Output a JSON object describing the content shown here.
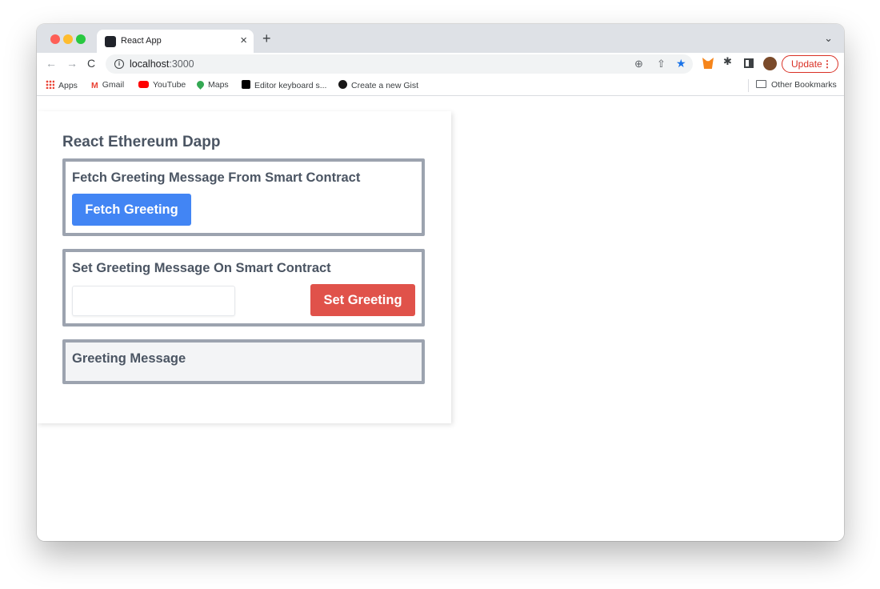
{
  "browser": {
    "tab_title": "React App",
    "tab_close": "×",
    "new_tab": "+",
    "tab_menu": "⌄",
    "url_host": "localhost",
    "url_port": ":3000",
    "update_label": "Update",
    "update_dots": "⋮",
    "nav_back": "←",
    "nav_forward": "→",
    "nav_reload": "C",
    "info_symbol": "i",
    "zoom_symbol": "⊕",
    "share_symbol": "⇧",
    "star_symbol": "★",
    "puzzle_symbol": "✱"
  },
  "bookmarks": {
    "items": [
      {
        "label": "Apps",
        "icon": "apps-grid-icon"
      },
      {
        "label": "Gmail",
        "icon": "gmail-icon"
      },
      {
        "label": "YouTube",
        "icon": "youtube-icon"
      },
      {
        "label": "Maps",
        "icon": "maps-icon"
      },
      {
        "label": "Editor keyboard s...",
        "icon": "medium-icon"
      },
      {
        "label": "Create a new Gist",
        "icon": "github-icon"
      }
    ],
    "other": "Other Bookmarks",
    "gmail_glyph": "M"
  },
  "app": {
    "title": "React Ethereum Dapp",
    "fetch_heading": "Fetch Greeting Message From Smart Contract",
    "fetch_button": "Fetch Greeting",
    "set_heading": "Set Greeting Message On Smart Contract",
    "set_input_value": "",
    "set_button": "Set Greeting",
    "message_heading": "Greeting Message"
  },
  "colors": {
    "fetch_button": "#4285f4",
    "set_button": "#e0524a",
    "panel_border": "#9ca3af",
    "update_accent": "#d93025"
  }
}
